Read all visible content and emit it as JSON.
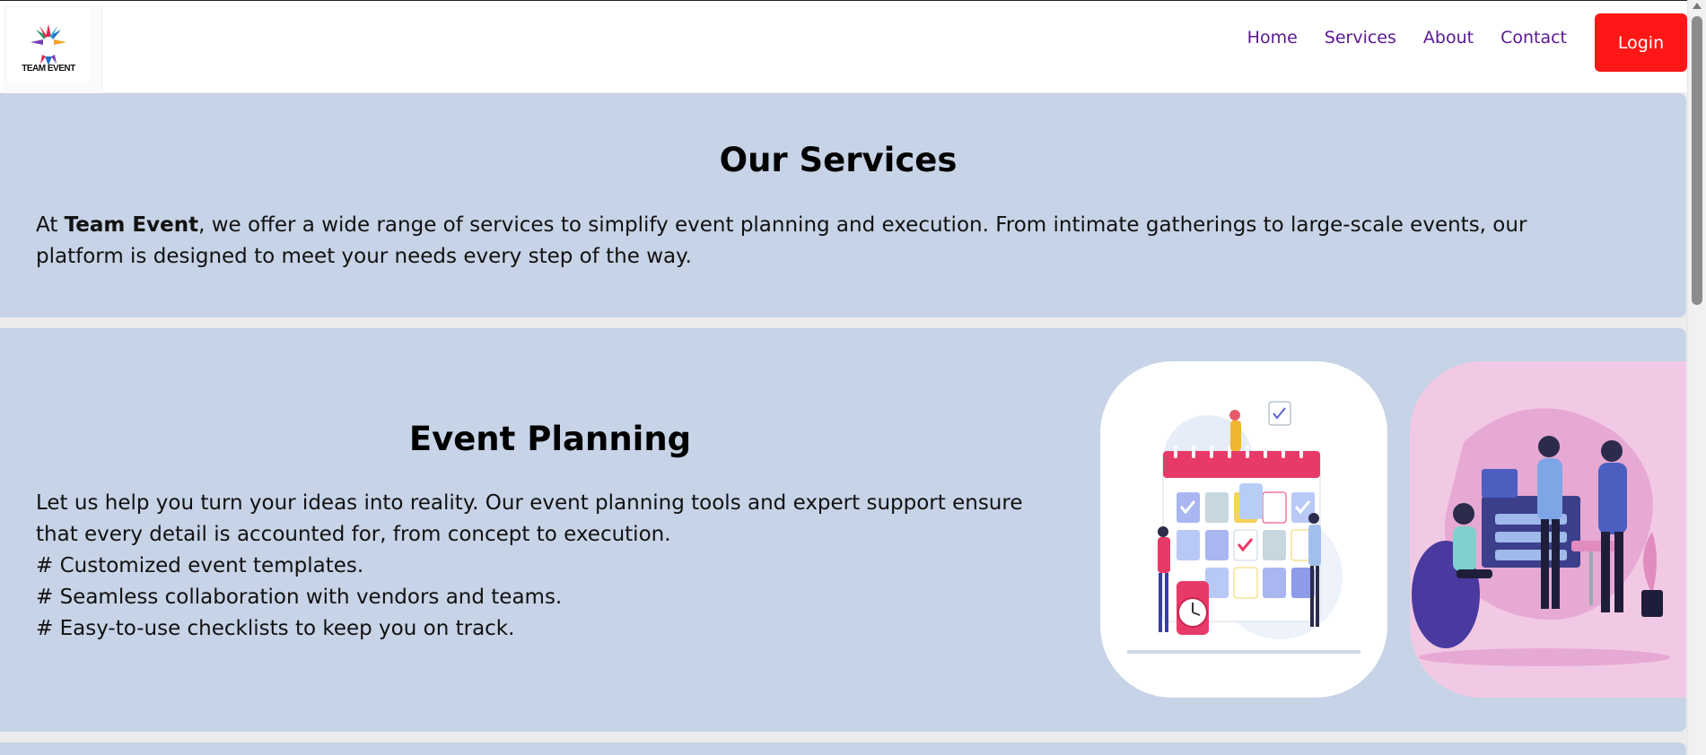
{
  "header": {
    "logo_text_top": "TEAM EVENT",
    "nav": [
      "Home",
      "Services",
      "About",
      "Contact"
    ],
    "login_label": "Login"
  },
  "services_intro": {
    "title": "Our Services",
    "text_prefix": "At ",
    "brand": "Team Event",
    "text_suffix": ", we offer a wide range of services to simplify event planning and execution. From intimate gatherings to large-scale events, our platform is designed to meet your needs every step of the way."
  },
  "event_planning": {
    "title": "Event Planning",
    "lines": [
      "Let us help you turn your ideas into reality. Our event planning tools and expert support ensure",
      "that every detail is accounted for, from concept to execution.",
      "# Customized event templates.",
      "# Seamless collaboration with vendors and teams.",
      "# Easy-to-use checklists to keep you on track."
    ]
  },
  "colors": {
    "nav_text": "#5a1890",
    "login_bg": "#ff1616",
    "section_bg": "#c7d3e6"
  }
}
